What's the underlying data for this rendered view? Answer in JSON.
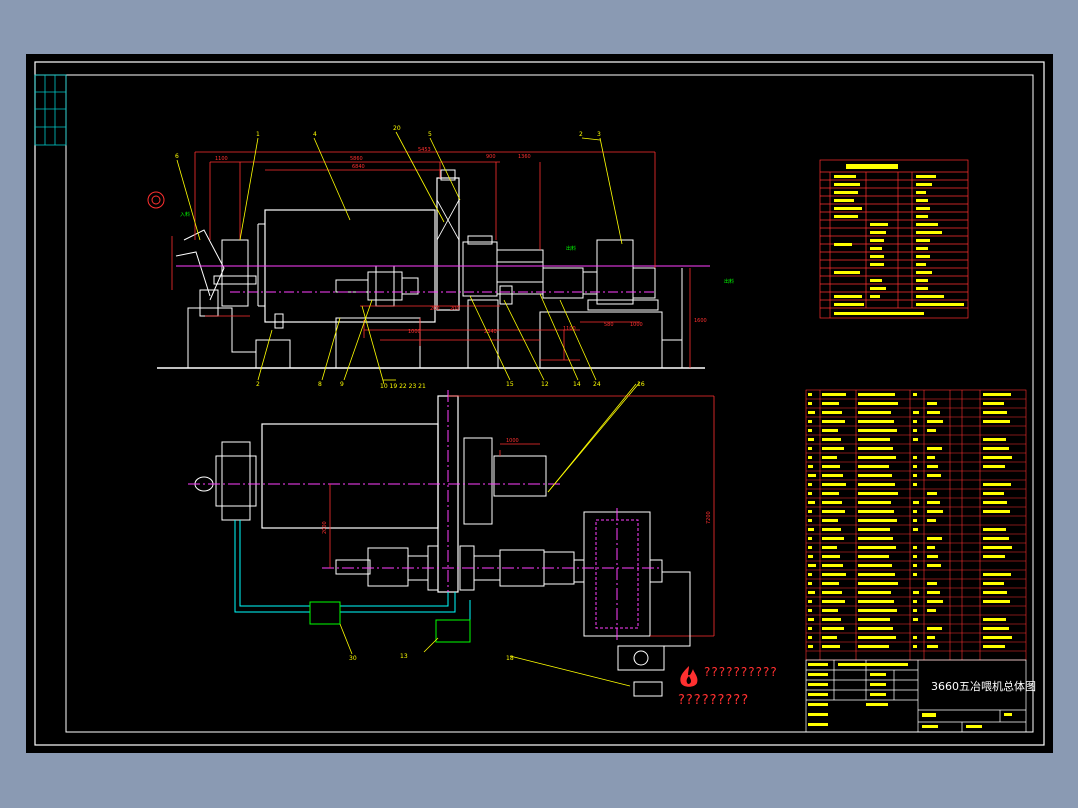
{
  "drawing": {
    "title": "3660五冶喂机总体图",
    "watermark_line1": "??????????",
    "watermark_line2": "?????????"
  },
  "colors": {
    "background": "#8a9ab3",
    "sheet": "#000000",
    "frame": "#ffffff",
    "outline": "#ffffff",
    "dimension": "#ff3030",
    "centerline": "#ff40ff",
    "leader": "#ffff00",
    "pipe": "#00ffff",
    "table_grid": "#ff3030",
    "table_text": "#ffff00"
  }
}
